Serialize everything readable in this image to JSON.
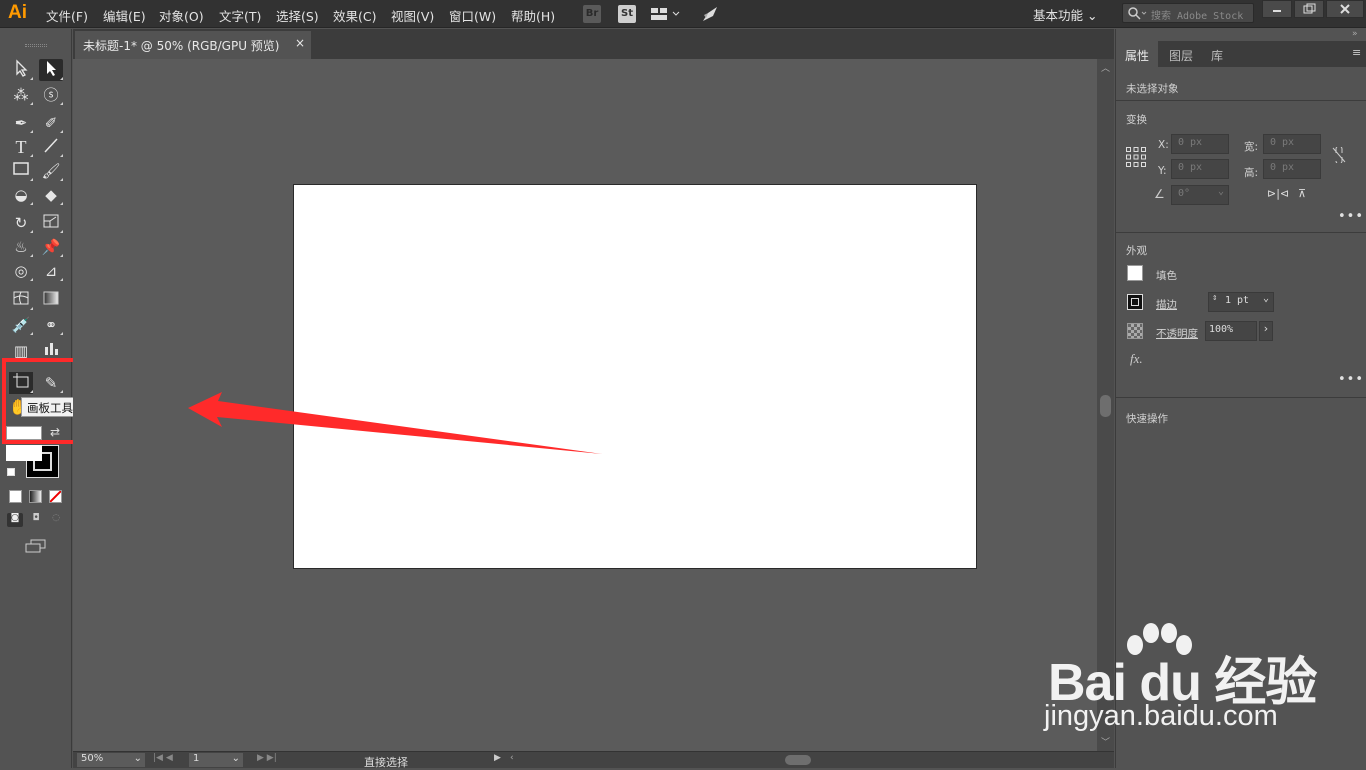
{
  "app": {
    "logo": "Ai",
    "menus": [
      "文件(F)",
      "编辑(E)",
      "对象(O)",
      "文字(T)",
      "选择(S)",
      "效果(C)",
      "视图(V)",
      "窗口(W)",
      "帮助(H)"
    ],
    "bridge_label": "Br",
    "stock_label": "St",
    "workspace": "基本功能",
    "search_placeholder": "搜索 Adobe Stock"
  },
  "document": {
    "tab_title": "未标题-1* @ 50% (RGB/GPU 预览)",
    "close_glyph": "×"
  },
  "toolbox": {
    "tooltip": "画板工具 (Shift+O)"
  },
  "status": {
    "zoom": "50%",
    "page": "1",
    "current_tool": "直接选择"
  },
  "panel": {
    "tabs": [
      "属性",
      "图层",
      "库"
    ],
    "no_selection": "未选择对象",
    "transform_title": "变换",
    "x_label": "X:",
    "y_label": "Y:",
    "w_label": "宽:",
    "h_label": "高:",
    "x_value": "0 px",
    "y_value": "0 px",
    "w_value": "0 px",
    "h_value": "0 px",
    "angle_value": "0°",
    "appearance_title": "外观",
    "fill_label": "填色",
    "stroke_label": "描边",
    "stroke_value": "1 pt",
    "opacity_label": "不透明度",
    "opacity_value": "100%",
    "fx_label": "fx.",
    "quick_actions_title": "快速操作"
  },
  "watermark": {
    "line1": "Bai du 经验",
    "line2": "jingyan.baidu.com"
  },
  "colors": {
    "annotation": "#ff2a2a",
    "logo": "#ff9a00"
  }
}
